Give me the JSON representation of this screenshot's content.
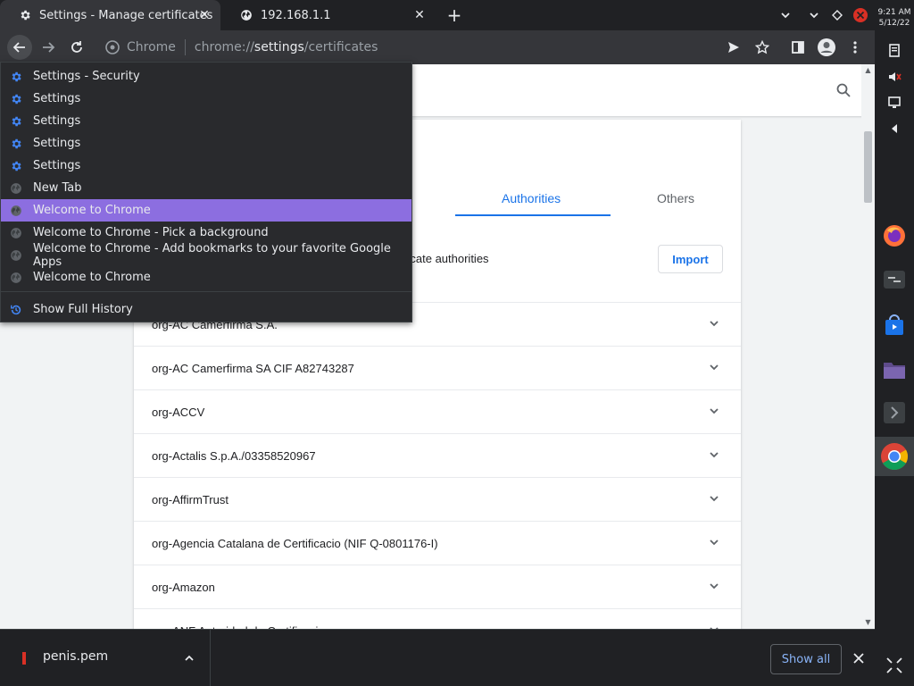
{
  "tabs": [
    {
      "title": "Settings - Manage certificates",
      "icon": "gear-icon"
    },
    {
      "title": "192.168.1.1",
      "icon": "globe-icon"
    }
  ],
  "omnibox": {
    "chip": "Chrome",
    "url_scheme": "chrome://",
    "url_host": "settings",
    "url_path": "/certificates"
  },
  "clock": {
    "time": "9:21 AM",
    "date": "5/12/22"
  },
  "history_menu": {
    "items": [
      {
        "title": "Settings - Security",
        "icon": "gear-icon"
      },
      {
        "title": "Settings",
        "icon": "gear-icon"
      },
      {
        "title": "Settings",
        "icon": "gear-icon"
      },
      {
        "title": "Settings",
        "icon": "gear-icon"
      },
      {
        "title": "Settings",
        "icon": "gear-icon"
      },
      {
        "title": "New Tab",
        "icon": "globe-icon"
      },
      {
        "title": "Welcome to Chrome",
        "icon": "globe-icon",
        "selected": true
      },
      {
        "title": "Welcome to Chrome - Pick a background",
        "icon": "globe-icon"
      },
      {
        "title": "Welcome to Chrome - Add bookmarks to your favorite Google Apps",
        "icon": "globe-icon"
      },
      {
        "title": "Welcome to Chrome",
        "icon": "globe-icon"
      }
    ],
    "show_full_history": "Show Full History"
  },
  "certificates": {
    "tabs": {
      "authorities": "Authorities",
      "others": "Others"
    },
    "description": "ificate authorities",
    "import_label": "Import",
    "rows": [
      "org-AC Camerfirma S.A.",
      "org-AC Camerfirma SA CIF A82743287",
      "org-ACCV",
      "org-Actalis S.p.A./03358520967",
      "org-AffirmTrust",
      "org-Agencia Catalana de Certificacio (NIF Q-0801176-I)",
      "org-Amazon",
      "org-ANF Autoridad de Certificacion"
    ]
  },
  "download_bar": {
    "file_name": "penis.pem",
    "show_all_label": "Show all"
  },
  "colors": {
    "accent": "#1a73e8",
    "selected_history": "#8c6ee0",
    "dark_bg": "#202124"
  }
}
